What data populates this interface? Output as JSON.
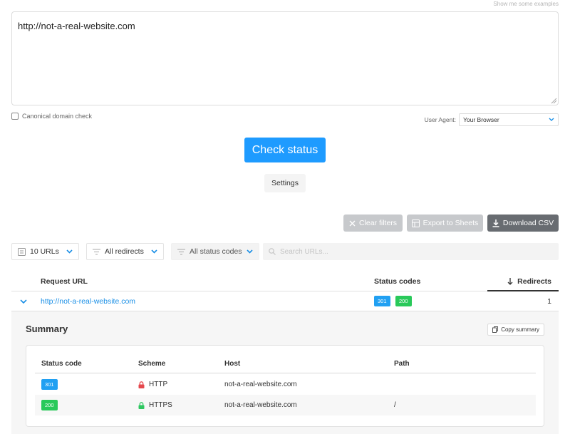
{
  "header": {
    "examples_link": "Show me some examples"
  },
  "input": {
    "url_text": "http://not-a-real-website.com"
  },
  "options": {
    "canonical_label": "Canonical domain check",
    "user_agent_label": "User Agent:",
    "user_agent_value": "Your Browser"
  },
  "actions": {
    "check_status": "Check status",
    "settings": "Settings",
    "clear_filters": "Clear filters",
    "export_sheets": "Export to Sheets",
    "download_csv": "Download CSV"
  },
  "filters": {
    "urls_count": "10 URLs",
    "redirects": "All redirects",
    "status_codes": "All status codes",
    "search_placeholder": "Search URLs..."
  },
  "table": {
    "headers": {
      "request_url": "Request URL",
      "status_codes": "Status codes",
      "redirects": "Redirects"
    },
    "rows": [
      {
        "url": "http://not-a-real-website.com",
        "codes": [
          "301",
          "200"
        ],
        "redirects": "1"
      }
    ]
  },
  "summary": {
    "title": "Summary",
    "copy_label": "Copy summary",
    "headers": {
      "status_code": "Status code",
      "scheme": "Scheme",
      "host": "Host",
      "path": "Path"
    },
    "rows": [
      {
        "status_code": "301",
        "scheme": "HTTP",
        "host": "not-a-real-website.com",
        "path": "",
        "lock_color": "#e5484d"
      },
      {
        "status_code": "200",
        "scheme": "HTTPS",
        "host": "not-a-real-website.com",
        "path": "/",
        "lock_color": "#2ec760"
      }
    ]
  },
  "colors": {
    "primary": "#1e9bff",
    "link": "#1a8fe6",
    "badge_301": "#21a0f2",
    "badge_200": "#29c95a",
    "dark_button": "#686c71",
    "disabled_button": "#c7c9cc"
  },
  "icons": [
    "resize-grip-icon",
    "chevron-down-icon",
    "list-icon",
    "filter-icon",
    "search-icon",
    "close-icon",
    "sheets-icon",
    "download-icon",
    "arrow-down-icon",
    "copy-icon",
    "lock-icon"
  ]
}
